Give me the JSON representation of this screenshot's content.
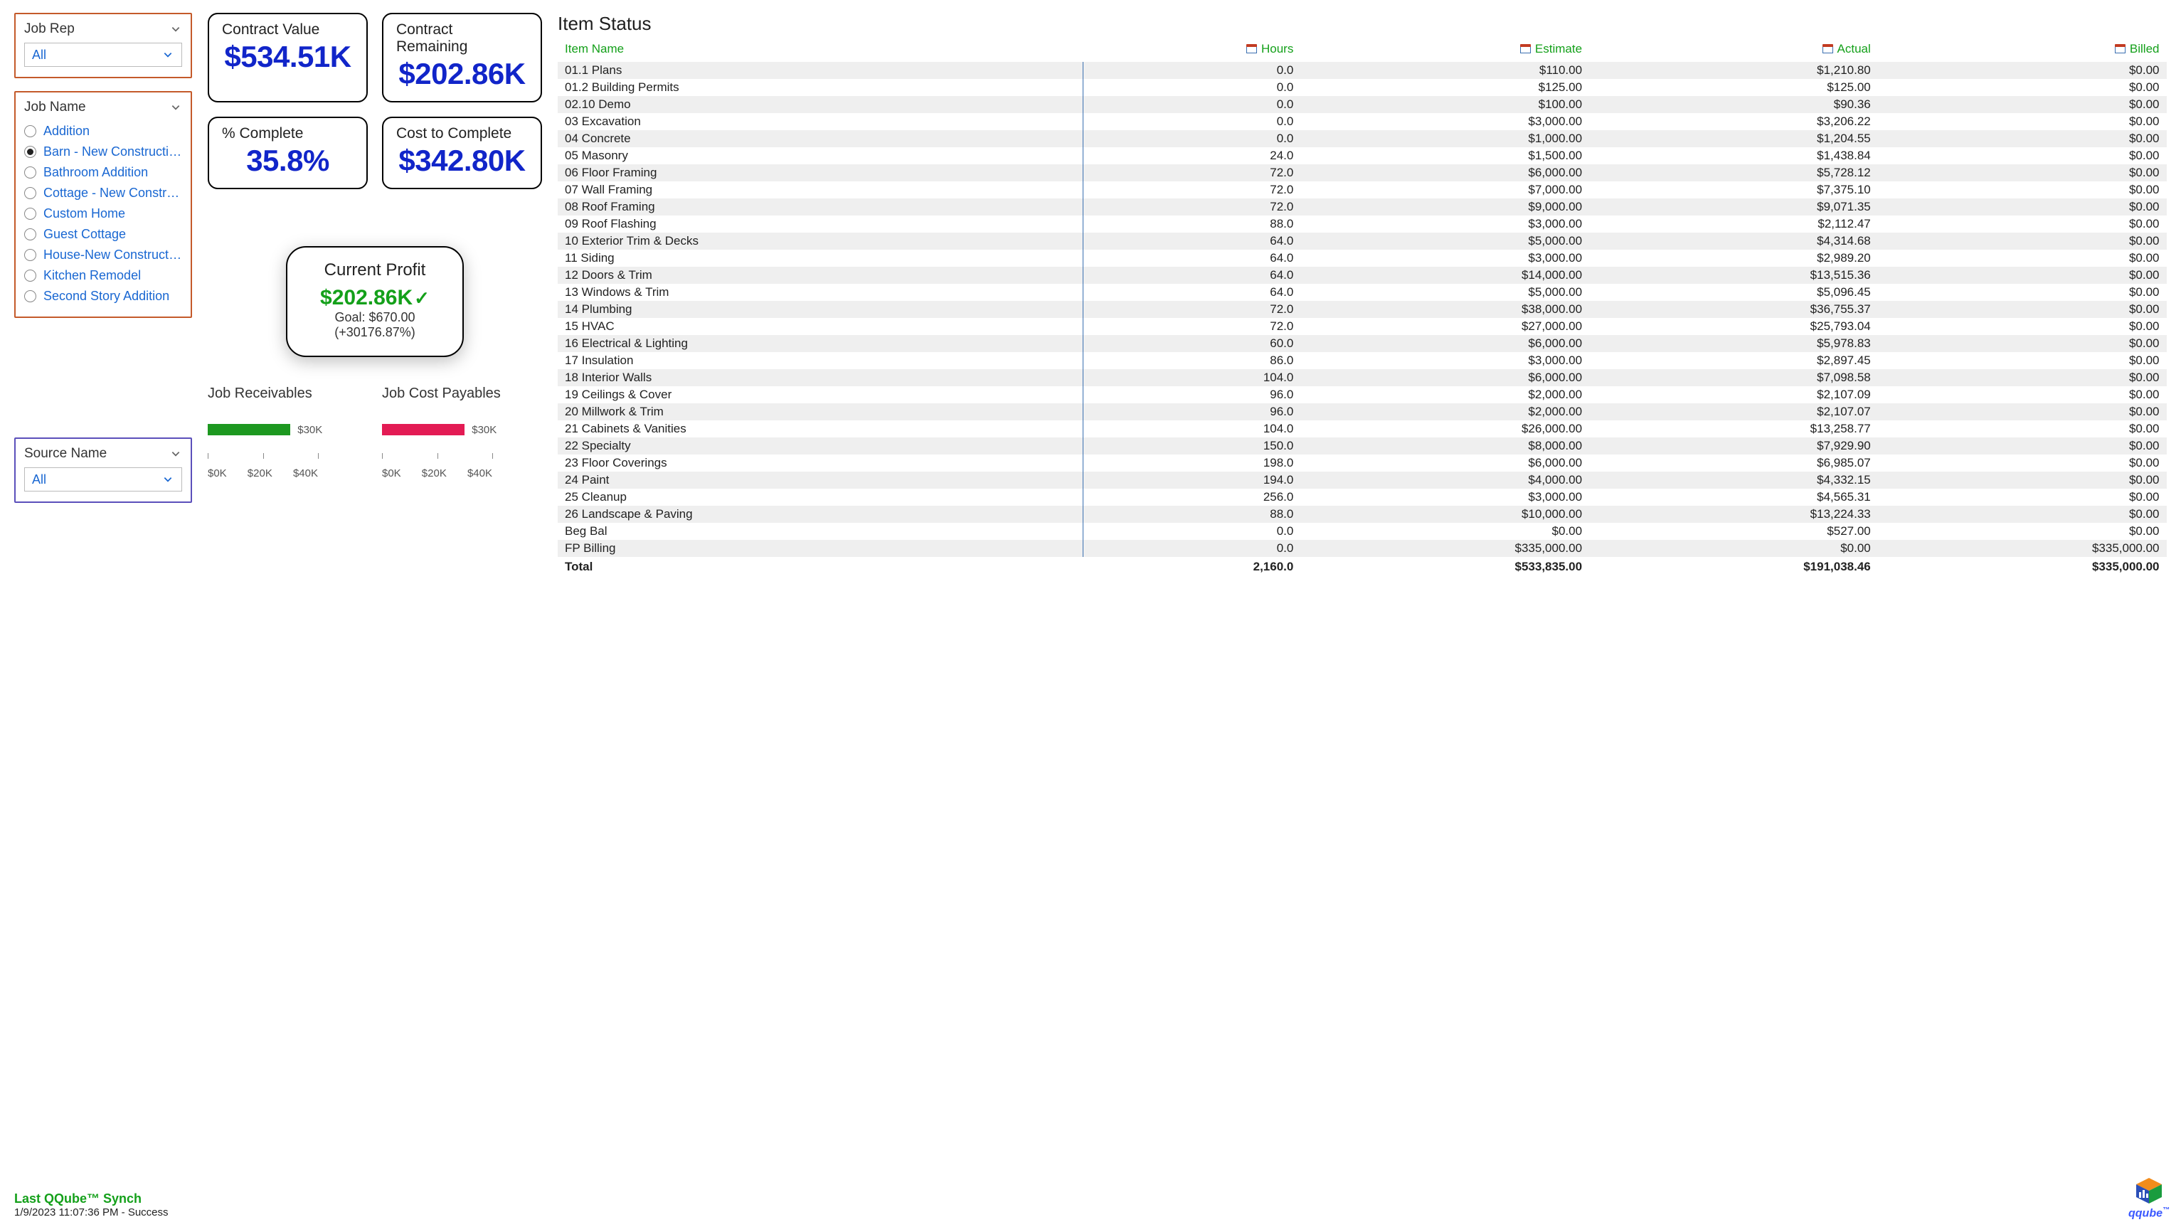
{
  "filters": {
    "job_rep": {
      "label": "Job Rep",
      "value": "All"
    },
    "job_name": {
      "label": "Job Name",
      "selected_index": 1,
      "options": [
        "Addition",
        "Barn - New Construction",
        "Bathroom Addition",
        "Cottage - New Constructi...",
        "Custom Home",
        "Guest Cottage",
        "House-New Construction",
        "Kitchen Remodel",
        "Second Story Addition"
      ]
    },
    "source_name": {
      "label": "Source Name",
      "value": "All"
    }
  },
  "kpis": {
    "contract_value": {
      "label": "Contract Value",
      "value": "$534.51K"
    },
    "contract_remaining": {
      "label": "Contract Remaining",
      "value": "$202.86K"
    },
    "pct_complete": {
      "label": "% Complete",
      "value": "35.8%"
    },
    "cost_to_complete": {
      "label": "Cost to Complete",
      "value": "$342.80K"
    }
  },
  "profit": {
    "title": "Current Profit",
    "value": "$202.86K",
    "goal": "Goal: $670.00",
    "delta": "(+30176.87%)"
  },
  "chart_data": [
    {
      "type": "bar",
      "title": "Job Receivables",
      "categories": [
        ""
      ],
      "values": [
        30000
      ],
      "value_label": "$30K",
      "xlim": [
        0,
        40000
      ],
      "xticks_labels": [
        "$0K",
        "$20K",
        "$40K"
      ],
      "color": "#1d9820"
    },
    {
      "type": "bar",
      "title": "Job Cost Payables",
      "categories": [
        ""
      ],
      "values": [
        30000
      ],
      "value_label": "$30K",
      "xlim": [
        0,
        40000
      ],
      "xticks_labels": [
        "$0K",
        "$20K",
        "$40K"
      ],
      "color": "#e31b54"
    }
  ],
  "table": {
    "title": "Item Status",
    "headers": [
      "Item Name",
      "Hours",
      "Estimate",
      "Actual",
      "Billed"
    ],
    "rows": [
      [
        "01.1 Plans",
        "0.0",
        "$110.00",
        "$1,210.80",
        "$0.00"
      ],
      [
        "01.2 Building Permits",
        "0.0",
        "$125.00",
        "$125.00",
        "$0.00"
      ],
      [
        "02.10 Demo",
        "0.0",
        "$100.00",
        "$90.36",
        "$0.00"
      ],
      [
        "03 Excavation",
        "0.0",
        "$3,000.00",
        "$3,206.22",
        "$0.00"
      ],
      [
        "04 Concrete",
        "0.0",
        "$1,000.00",
        "$1,204.55",
        "$0.00"
      ],
      [
        "05 Masonry",
        "24.0",
        "$1,500.00",
        "$1,438.84",
        "$0.00"
      ],
      [
        "06 Floor Framing",
        "72.0",
        "$6,000.00",
        "$5,728.12",
        "$0.00"
      ],
      [
        "07 Wall Framing",
        "72.0",
        "$7,000.00",
        "$7,375.10",
        "$0.00"
      ],
      [
        "08 Roof Framing",
        "72.0",
        "$9,000.00",
        "$9,071.35",
        "$0.00"
      ],
      [
        "09 Roof Flashing",
        "88.0",
        "$3,000.00",
        "$2,112.47",
        "$0.00"
      ],
      [
        "10 Exterior Trim & Decks",
        "64.0",
        "$5,000.00",
        "$4,314.68",
        "$0.00"
      ],
      [
        "11 Siding",
        "64.0",
        "$3,000.00",
        "$2,989.20",
        "$0.00"
      ],
      [
        "12 Doors & Trim",
        "64.0",
        "$14,000.00",
        "$13,515.36",
        "$0.00"
      ],
      [
        "13 Windows & Trim",
        "64.0",
        "$5,000.00",
        "$5,096.45",
        "$0.00"
      ],
      [
        "14 Plumbing",
        "72.0",
        "$38,000.00",
        "$36,755.37",
        "$0.00"
      ],
      [
        "15 HVAC",
        "72.0",
        "$27,000.00",
        "$25,793.04",
        "$0.00"
      ],
      [
        "16 Electrical & Lighting",
        "60.0",
        "$6,000.00",
        "$5,978.83",
        "$0.00"
      ],
      [
        "17 Insulation",
        "86.0",
        "$3,000.00",
        "$2,897.45",
        "$0.00"
      ],
      [
        "18 Interior Walls",
        "104.0",
        "$6,000.00",
        "$7,098.58",
        "$0.00"
      ],
      [
        "19 Ceilings & Cover",
        "96.0",
        "$2,000.00",
        "$2,107.09",
        "$0.00"
      ],
      [
        "20 Millwork & Trim",
        "96.0",
        "$2,000.00",
        "$2,107.07",
        "$0.00"
      ],
      [
        "21 Cabinets & Vanities",
        "104.0",
        "$26,000.00",
        "$13,258.77",
        "$0.00"
      ],
      [
        "22 Specialty",
        "150.0",
        "$8,000.00",
        "$7,929.90",
        "$0.00"
      ],
      [
        "23 Floor Coverings",
        "198.0",
        "$6,000.00",
        "$6,985.07",
        "$0.00"
      ],
      [
        "24 Paint",
        "194.0",
        "$4,000.00",
        "$4,332.15",
        "$0.00"
      ],
      [
        "25 Cleanup",
        "256.0",
        "$3,000.00",
        "$4,565.31",
        "$0.00"
      ],
      [
        "26 Landscape & Paving",
        "88.0",
        "$10,000.00",
        "$13,224.33",
        "$0.00"
      ],
      [
        "Beg Bal",
        "0.0",
        "$0.00",
        "$527.00",
        "$0.00"
      ],
      [
        "FP Billing",
        "0.0",
        "$335,000.00",
        "$0.00",
        "$335,000.00"
      ]
    ],
    "total": [
      "Total",
      "2,160.0",
      "$533,835.00",
      "$191,038.46",
      "$335,000.00"
    ]
  },
  "sync": {
    "title": "Last QQube™ Synch",
    "detail": "1/9/2023 11:07:36 PM - Success"
  },
  "logo": {
    "text": "qqube",
    "tm": "™"
  }
}
